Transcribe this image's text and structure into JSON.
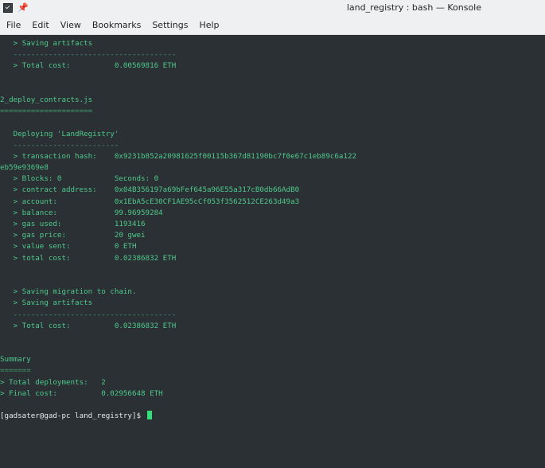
{
  "window": {
    "title": "land_registry : bash — Konsole"
  },
  "menubar": {
    "items": [
      "File",
      "Edit",
      "View",
      "Bookmarks",
      "Settings",
      "Help"
    ]
  },
  "terminal": {
    "lines": [
      "   > Saving artifacts",
      "   -------------------------------------",
      "   > Total cost:          0.00569816 ETH",
      "",
      "",
      "2_deploy_contracts.js",
      "=====================",
      "",
      "   Deploying 'LandRegistry'",
      "   ------------------------",
      "   > transaction hash:    0x9231b852a20981625f00115b367d81190bc7f0e67c1eb89c6a122",
      "eb59e9369e8",
      "   > Blocks: 0            Seconds: 0",
      "   > contract address:    0x04B356197a69bFef645a96E55a317cB0db66AdB0",
      "   > account:             0x1EbA5cE30CF1AE95cCf053f3562512CE263d49a3",
      "   > balance:             99.96959284",
      "   > gas used:            1193416",
      "   > gas price:           20 gwei",
      "   > value sent:          0 ETH",
      "   > total cost:          0.02386832 ETH",
      "",
      "",
      "   > Saving migration to chain.",
      "   > Saving artifacts",
      "   -------------------------------------",
      "   > Total cost:          0.02386832 ETH",
      "",
      "",
      "Summary",
      "=======",
      "> Total deployments:   2",
      "> Final cost:          0.02956648 ETH",
      ""
    ],
    "prompt": "[gadsater@gad-pc land_registry]$ "
  }
}
